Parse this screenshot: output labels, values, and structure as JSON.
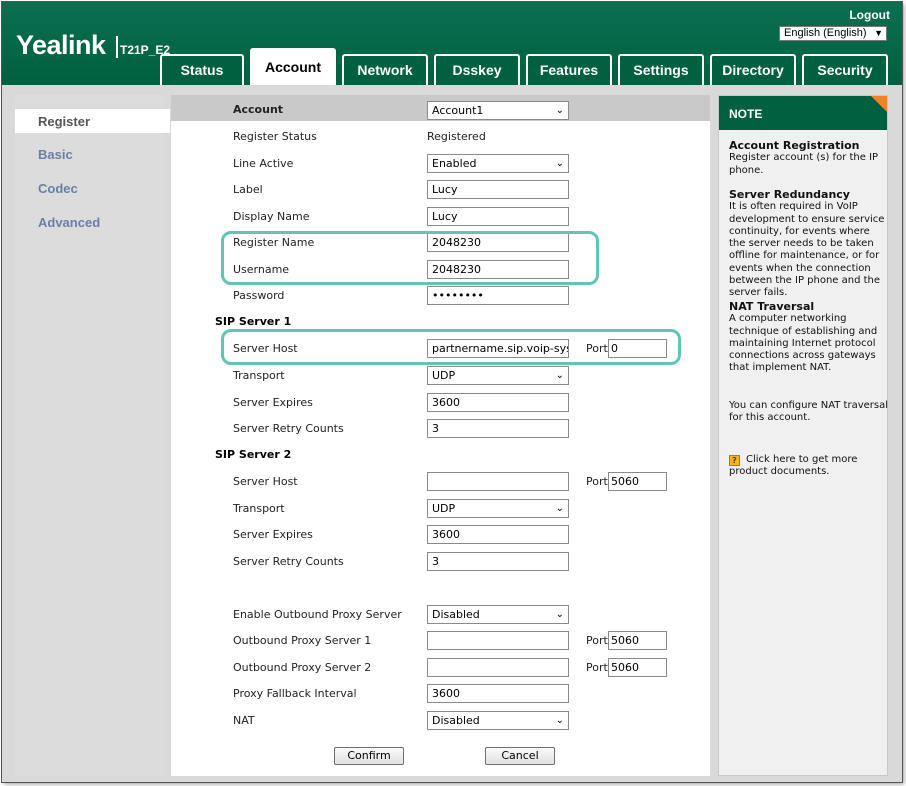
{
  "header": {
    "brand": "Yealink",
    "model": "T21P_E2",
    "logout": "Logout",
    "language": "English (English)"
  },
  "tabs": [
    {
      "label": "Status"
    },
    {
      "label": "Account"
    },
    {
      "label": "Network"
    },
    {
      "label": "Dsskey"
    },
    {
      "label": "Features"
    },
    {
      "label": "Settings"
    },
    {
      "label": "Directory"
    },
    {
      "label": "Security"
    }
  ],
  "active_tab": "Account",
  "sidebar": {
    "items": [
      {
        "label": "Register"
      },
      {
        "label": "Basic"
      },
      {
        "label": "Codec"
      },
      {
        "label": "Advanced"
      }
    ],
    "active": "Register"
  },
  "form": {
    "account": {
      "label": "Account",
      "value": "Account1"
    },
    "register_status": {
      "label": "Register Status",
      "value": "Registered"
    },
    "line_active": {
      "label": "Line Active",
      "value": "Enabled"
    },
    "label": {
      "label": "Label",
      "value": "Lucy"
    },
    "display_name": {
      "label": "Display Name",
      "value": "Lucy"
    },
    "register_name": {
      "label": "Register Name",
      "value": "2048230"
    },
    "username": {
      "label": "Username",
      "value": "2048230"
    },
    "password": {
      "label": "Password",
      "value": "••••••••"
    },
    "sip_server_1": {
      "title": "SIP Server 1",
      "server_host": {
        "label": "Server Host",
        "value": "partnername.sip.voip-system"
      },
      "port": {
        "label": "Port",
        "value": "0"
      },
      "transport": {
        "label": "Transport",
        "value": "UDP"
      },
      "server_expires": {
        "label": "Server Expires",
        "value": "3600"
      },
      "server_retry_counts": {
        "label": "Server Retry Counts",
        "value": "3"
      }
    },
    "sip_server_2": {
      "title": "SIP Server 2",
      "server_host": {
        "label": "Server Host",
        "value": ""
      },
      "port": {
        "label": "Port",
        "value": "5060"
      },
      "transport": {
        "label": "Transport",
        "value": "UDP"
      },
      "server_expires": {
        "label": "Server Expires",
        "value": "3600"
      },
      "server_retry_counts": {
        "label": "Server Retry Counts",
        "value": "3"
      }
    },
    "outbound_proxy": {
      "enable": {
        "label": "Enable Outbound Proxy Server",
        "value": "Disabled"
      },
      "server1": {
        "label": "Outbound Proxy Server 1",
        "value": "",
        "port_label": "Port",
        "port": "5060"
      },
      "server2": {
        "label": "Outbound Proxy Server 2",
        "value": "",
        "port_label": "Port",
        "port": "5060"
      },
      "fallback": {
        "label": "Proxy Fallback Interval",
        "value": "3600"
      },
      "nat": {
        "label": "NAT",
        "value": "Disabled"
      }
    },
    "buttons": {
      "confirm": "Confirm",
      "cancel": "Cancel"
    }
  },
  "note": {
    "title": "NOTE",
    "blocks": [
      {
        "heading": "Account Registration",
        "text": "Register account (s) for the IP phone."
      },
      {
        "heading": "Server Redundancy",
        "text": "It is often required in VoIP development to ensure service continuity, for events where the server needs to be taken offline for maintenance, or for events when the connection between the IP phone and the server fails."
      },
      {
        "heading": "NAT Traversal",
        "text": "A computer networking technique of establishing and maintaining Internet protocol connections across gateways that implement NAT."
      },
      {
        "heading": "",
        "text": "You can configure NAT traversal for this account."
      }
    ],
    "link": "Click here to get more product documents."
  },
  "colors": {
    "brand_green": "#00603f",
    "highlight": "#5ec6b4",
    "note_corner": "#f58220",
    "sidebar_link": "#6b7fa3"
  }
}
